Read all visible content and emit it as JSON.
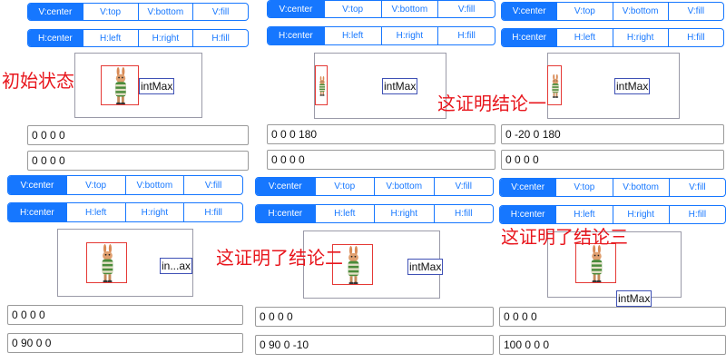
{
  "vertical_options": [
    "V:center",
    "V:top",
    "V:bottom",
    "V:fill"
  ],
  "horizontal_options": [
    "H:center",
    "H:left",
    "H:right",
    "H:fill"
  ],
  "accent_color": "#1677ff",
  "image_border_color": "#e53935",
  "label_border_color": "#3f51b5",
  "annotation_color": "#e8161d",
  "panels": [
    {
      "selected_v": "V:center",
      "selected_h": "H:center",
      "label_text": "intMax",
      "field1": "0 0 0 0",
      "field2": "0 0 0 0"
    },
    {
      "selected_v": "V:center",
      "selected_h": "H:center",
      "label_text": "intMax",
      "field1": "0 0 0 180",
      "field2": "0 0 0 0"
    },
    {
      "selected_v": "V:center",
      "selected_h": "H:center",
      "label_text": "intMax",
      "field1": "0 -20 0 180",
      "field2": "0 0 0 0"
    },
    {
      "selected_v": "V:center",
      "selected_h": "H:center",
      "label_text": "in...ax",
      "field1": "0 0 0 0",
      "field2": "0 90 0 0"
    },
    {
      "selected_v": "V:center",
      "selected_h": "H:center",
      "label_text": "intMax",
      "field1": "0 0 0 0",
      "field2": "0 90 0 -10"
    },
    {
      "selected_v": "V:center",
      "selected_h": "H:center",
      "label_text": "intMax",
      "field1": "0 0 0 0",
      "field2": "100 0 0 0"
    }
  ],
  "annotations": {
    "initial_state": "初始状态",
    "conclusion_one": "这证明结论一",
    "conclusion_two": "这证明了结论二",
    "conclusion_three": "这证明了结论三"
  }
}
